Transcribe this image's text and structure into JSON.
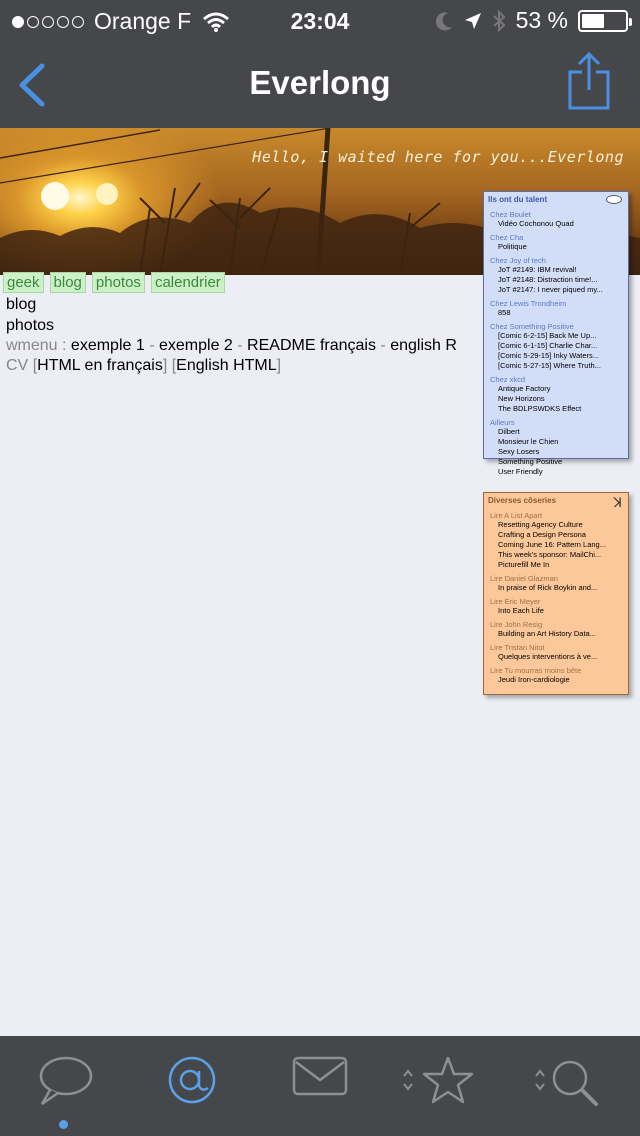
{
  "status": {
    "carrier": "Orange F",
    "time": "23:04",
    "battery": "53 %",
    "battery_level": 0.53,
    "signal_bars": 1,
    "signal_total": 5
  },
  "nav": {
    "title": "Everlong",
    "accent": "#4a90e2"
  },
  "banner": {
    "caption": "Hello, I waited here for you...Everlong"
  },
  "tags": [
    "geek",
    "blog",
    "photos",
    "calendrier"
  ],
  "content": {
    "line_blog": "blog",
    "line_photos": "photos",
    "wmenu_label": "wmenu :",
    "wmenu_items": [
      "exemple 1",
      "exemple 2",
      "README français",
      "english R"
    ],
    "sep": "-",
    "cv_label": "CV",
    "cv_links": [
      "HTML en français",
      "English HTML"
    ]
  },
  "widget_blue": {
    "title": "Ils ont du talent",
    "sections": [
      {
        "name": "Chez Boulet",
        "items": [
          "Vidéo Cochonou Quad"
        ]
      },
      {
        "name": "Chez Cha",
        "items": [
          "Politique"
        ]
      },
      {
        "name": "Chez Joy of tech",
        "items": [
          "JoT #2149: IBM revival!",
          "JoT #2148: Distraction time!...",
          "JoT #2147: I never piqued my..."
        ]
      },
      {
        "name": "Chez Lewis Trondheim",
        "items": [
          "858"
        ]
      },
      {
        "name": "Chez Something Positive",
        "items": [
          "[Comic 6-2-15] Back Me Up...",
          "[Comic 6-1-15] Charlie Char...",
          "[Comic 5-29-15] Inky Waters...",
          "[Comic 5-27-15] Where Truth..."
        ]
      },
      {
        "name": "Chez xkcd",
        "items": [
          "Antique Factory",
          "New Horizons",
          "The BDLPSWDKS Effect"
        ]
      },
      {
        "name": "Ailleurs",
        "items": [
          "Dilbert",
          "Monsieur le Chien",
          "Sexy Losers",
          "Something Positive",
          "User Friendly"
        ]
      }
    ]
  },
  "widget_orange": {
    "title": "Diverses côseries",
    "sections": [
      {
        "name": "Lire A List Apart",
        "items": [
          "Resetting Agency Culture",
          "Crafting a Design Persona",
          "Coming June 16: Pattern Lang...",
          "This week's sponsor: MailChi...",
          "Picturefill Me In"
        ]
      },
      {
        "name": "Lire Daniel Glazman",
        "items": [
          "In praise of Rick Boykin and..."
        ]
      },
      {
        "name": "Lire Eric Meyer",
        "items": [
          "Into Each Life"
        ]
      },
      {
        "name": "Lire John Resig",
        "items": [
          "Building an Art History Data..."
        ]
      },
      {
        "name": "Lire Tristan Nitot",
        "items": [
          "Quelques interventions à ve..."
        ]
      },
      {
        "name": "Lire Tu mourras moins bête",
        "items": [
          "Jeudi Iron-cardiologie"
        ]
      }
    ]
  },
  "tabbar": {
    "tabs": [
      {
        "icon": "chat-bubble-icon",
        "active": false
      },
      {
        "icon": "at-sign-icon",
        "active": true
      },
      {
        "icon": "envelope-icon",
        "active": false
      },
      {
        "icon": "star-icon",
        "active": false
      },
      {
        "icon": "search-icon",
        "active": false
      }
    ],
    "active_color": "#5aa0e8",
    "inactive_color": "#8e8f94"
  }
}
